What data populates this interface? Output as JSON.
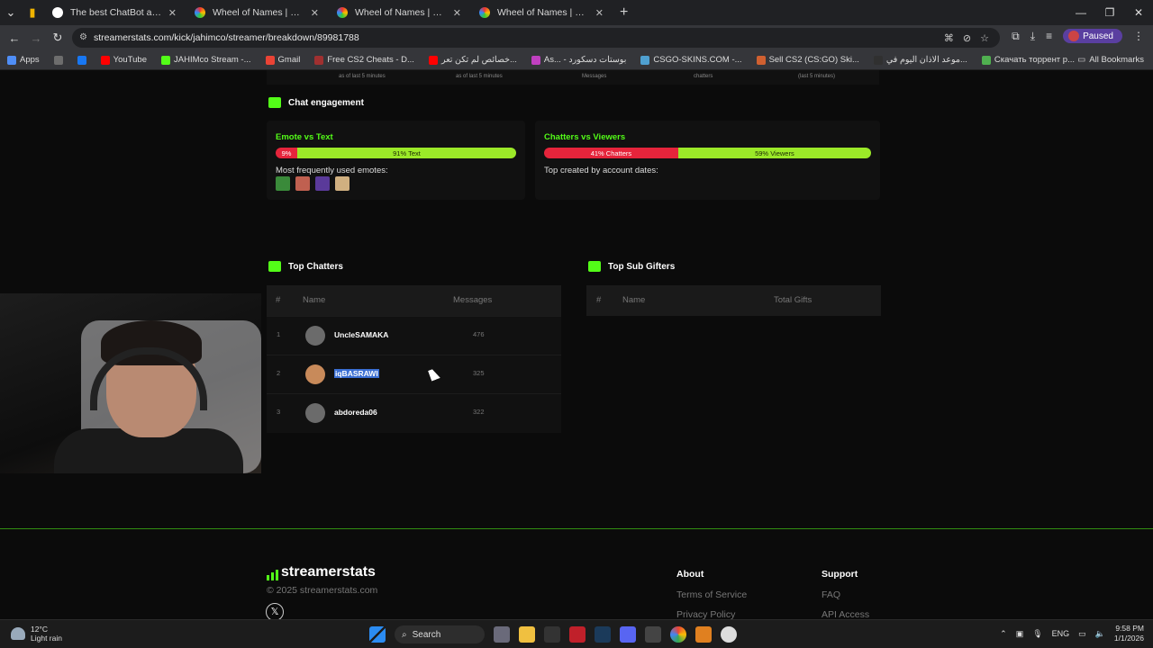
{
  "browser": {
    "tabs": [
      {
        "title": "The best ChatBot and Widgets",
        "color": "#ffffff"
      },
      {
        "title": "Wheel of Names | سم العشوائي",
        "color": "#4f8ef7"
      },
      {
        "title": "Wheel of Names | سم العشوائي",
        "color": "#4f8ef7"
      },
      {
        "title": "Wheel of Names | سم العشوائي",
        "color": "#4f8ef7"
      }
    ],
    "url": "streamerstats.com/kick/jahimco/streamer/breakdown/89981788",
    "profile_label": "Paused",
    "bookmarks": [
      {
        "label": "Apps",
        "color": "#4f8ef7"
      },
      {
        "label": "",
        "color": "#6d6d6d"
      },
      {
        "label": "",
        "color": "#1877f2"
      },
      {
        "label": "YouTube",
        "color": "#ff0000"
      },
      {
        "label": "JAHIMco Stream -...",
        "color": "#53fc18"
      },
      {
        "label": "Gmail",
        "color": "#ea4335"
      },
      {
        "label": "Free CS2 Cheats - D...",
        "color": "#a03030"
      },
      {
        "label": "خصائص لم تكن تعر...",
        "color": "#ff0000"
      },
      {
        "label": "As... - بوستات دسكورد",
        "color": "#c040c0"
      },
      {
        "label": "CSGO-SKINS.COM -...",
        "color": "#4fa0d0"
      },
      {
        "label": "Sell CS2 (CS:GO) Ski...",
        "color": "#d06030"
      },
      {
        "label": "موعد الاذان اليوم في...",
        "color": "#303030"
      },
      {
        "label": "Скачать торрент р...",
        "color": "#50b050"
      }
    ],
    "all_bookmarks": "All Bookmarks"
  },
  "stats_strip": [
    "as of last 5 minutes",
    "as of last 5 minutes",
    "Messages",
    "chatters",
    "(last 5 minutes)"
  ],
  "chat_engagement": {
    "title": "Chat engagement",
    "emote_card": {
      "title": "Emote vs Text",
      "left_label": "9%",
      "left_fraction": 0.09,
      "right_label": "91% Text",
      "emotes_label": "Most frequently used emotes:",
      "emote_colors": [
        "#3a8a3a",
        "#c06050",
        "#5a3a9a",
        "#d0b080"
      ]
    },
    "chatter_card": {
      "title": "Chatters vs Viewers",
      "left_label": "41% Chatters",
      "left_fraction": 0.41,
      "right_label": "59% Viewers",
      "dates_label": "Top created by account dates:"
    }
  },
  "top_chatters": {
    "title": "Top Chatters",
    "headers": {
      "rank": "#",
      "name": "Name",
      "messages": "Messages"
    },
    "rows": [
      {
        "rank": "1",
        "name": "UncleSAMAKA",
        "messages": "476",
        "avatar": "#6b6b6b",
        "selected": false
      },
      {
        "rank": "2",
        "name": "iqBASRAWI",
        "messages": "325",
        "avatar": "#c88a5a",
        "selected": true
      },
      {
        "rank": "3",
        "name": "abdoreda06",
        "messages": "322",
        "avatar": "#6b6b6b",
        "selected": false
      }
    ]
  },
  "top_sub_gifters": {
    "title": "Top Sub Gifters",
    "headers": {
      "rank": "#",
      "name": "Name",
      "gifts": "Total Gifts"
    }
  },
  "footer": {
    "logo": "streamerstats",
    "copyright": "© 2025 streamerstats.com",
    "about": {
      "title": "About",
      "links": [
        "Terms of Service",
        "Privacy Policy"
      ]
    },
    "support": {
      "title": "Support",
      "links": [
        "FAQ",
        "API Access"
      ]
    }
  },
  "taskbar": {
    "temp": "12°C",
    "weather": "Light rain",
    "search": "Search",
    "lang": "ENG",
    "time": "9:58 PM",
    "date": "1/1/2026"
  },
  "colors": {
    "accent": "#53fc18",
    "red": "#e5243b",
    "lime": "#9be928"
  }
}
